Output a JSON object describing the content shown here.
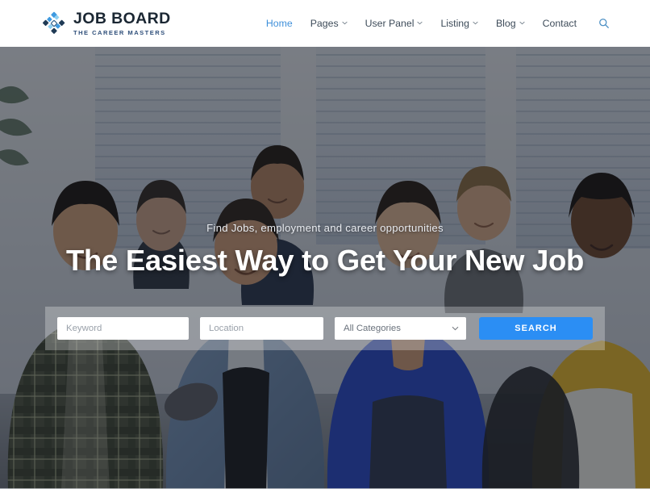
{
  "header": {
    "brand": {
      "logo_icon": "job-board-diamond-cluster-logo",
      "title": "JOB BOARD",
      "tagline": "THE CAREER MASTERS",
      "title_color": "#1b2733",
      "tagline_color": "#2f4f7a"
    },
    "nav": {
      "items": [
        {
          "label": "Home",
          "has_dropdown": false,
          "active": true
        },
        {
          "label": "Pages",
          "has_dropdown": true,
          "active": false
        },
        {
          "label": "User Panel",
          "has_dropdown": true,
          "active": false
        },
        {
          "label": "Listing",
          "has_dropdown": true,
          "active": false
        },
        {
          "label": "Blog",
          "has_dropdown": true,
          "active": false
        },
        {
          "label": "Contact",
          "has_dropdown": false,
          "active": false
        }
      ],
      "search_icon": "search-icon",
      "active_color": "#3f90da",
      "text_color": "#3d4b59"
    }
  },
  "hero": {
    "subtitle": "Find Jobs, employment and career opportunities",
    "title": "The Easiest Way to Get Your New Job",
    "background_image": "group-of-smiling-young-professionals-in-office",
    "search": {
      "keyword": {
        "value": "",
        "placeholder": "Keyword"
      },
      "location": {
        "value": "",
        "placeholder": "Location"
      },
      "category": {
        "selected": "All Categories",
        "options": [
          "All Categories"
        ],
        "chevron_icon": "chevron-down-icon"
      },
      "submit_label": "SEARCH",
      "submit_color": "#2b8ef4"
    }
  }
}
